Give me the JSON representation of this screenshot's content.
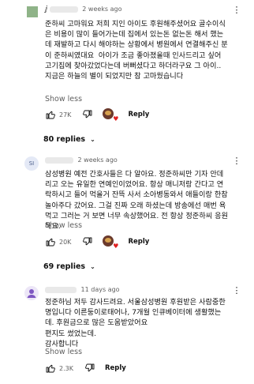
{
  "comments": [
    {
      "avatar_text": "",
      "avatar_color": "#8fb388",
      "prefix": "",
      "time": "2 weeks ago",
      "text": "준하씨 고마워요 저희 지인 아이도 후원해주셨어요 골수이식은 비용이 많이 들어가는데 집에서 있는돈 없는돈 해서 했는데 재발하고 다시 해야하는 상황에서 병원에서 연결해주신 분이 준하씨였대요  아이가 조금 좋아졌을때 인사드리고 싶어 고기집에 찾아갔었다는데 버뻐셨다고 하더라구요 그 아이.. 지금은 하늘의 별이 되었지만 참 고마웠습니다",
      "show_less": "Show less",
      "likes": "27K",
      "reply": "Reply",
      "replies": "80 replies"
    },
    {
      "avatar_text": "SI",
      "avatar_color": "#5c7dc2",
      "prefix": "",
      "time": "2 weeks ago",
      "text": "삼성병원 예전 간호사들은 다 알아요. 정준하씨만 기자 안데리고 오는 유일한 연예인이었어요. 항상 매니저랑 간다고 연락하시고 들어 먹을거 잔뜩 사서 소아병동와서 애들이랑 한참 놀아주다 갔어요. 그걸 진짜 오래 하셨는데 방송에선 매번 욕 먹고 그러는 거 보면 너무 속상했어요. 전 항상 정준하씨 응원해요.",
      "show_less": "Show less",
      "likes": "20K",
      "reply": "Reply",
      "replies": "69 replies"
    },
    {
      "avatar_text": "",
      "avatar_color": "#7e57c2",
      "prefix": "",
      "time": "11 days ago",
      "text": "정준하님 저두 감사드려요. 서울삼성병원 후원받은 사람중한명입니다 이른둥이로태어나, 7개월 인큐베이터에 생활했는데. 후원금으로 많은 도움받았어요\n편지도 썼었는데.\n감사합니다",
      "show_less": "Show less",
      "likes": "2.3K",
      "reply": "Reply"
    }
  ]
}
